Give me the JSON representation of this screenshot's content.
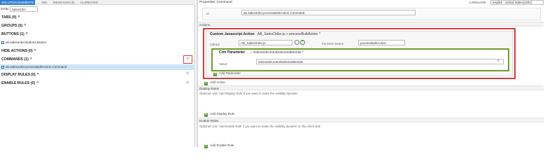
{
  "left_tabs": [
    "SOLUTION ELEMENTS",
    "XML",
    "MESSAGES (0)",
    "CLIPBOARD"
  ],
  "entity": {
    "label": "Entity:",
    "value": "salesorder"
  },
  "sections": {
    "tabs": "TABS (0)",
    "groups": "GROUPS (0)",
    "buttons": "BUTTONS (1)",
    "hide_actions": "HIDE ACTIONS (0)",
    "commands": "COMMANDS (1)",
    "display_rules": "DISPLAY RULES (0)",
    "enable_rules": "ENABLE RULES (0)"
  },
  "button_item": "ab.salesorder.Button2.Button",
  "command_item": "ab.salesorder.processBulkAction.Command",
  "properties_title": "Properties: Command",
  "language": {
    "label": "LANGUAGE:",
    "value": "English - United States(1033)"
  },
  "id": {
    "label": "Id",
    "value": "ab.salesorder.processBulkAction.Command"
  },
  "actions_label": "Actions",
  "cja": {
    "title": "Custom Javascript Action",
    "subtitle": "AB_SalesOrder.js > processBulkAction",
    "library_label": "Library",
    "library_value": "AB_SalesOrder.js",
    "function_label": "Function Name",
    "function_value": "processBulkAction"
  },
  "crm": {
    "title": "Crm Parameter",
    "subtitle": "= SelectedControlSelectedItemIds",
    "value_label": "Value",
    "value": "SelectedControlSelectedItemIds"
  },
  "add_parameter": "Add Parameter",
  "add_action": "Add Action",
  "display_rules_label": "Display Rules",
  "display_optional": "Optional: Use 'Add Display Rule' if you want to make the visibility dynamic.",
  "add_display_rule": "Add Display Rule",
  "enable_rules_label": "Enable Rules",
  "enable_optional": "Optional: Use 'Add Enable Rule' if you want to make the visibility dynamic on the client side",
  "add_enable_rule": "Add Enable Rule",
  "colors": {
    "selected_row": "#cde4f7",
    "tab_active": "#2f7fcf",
    "highlight_red": "#d23b3b",
    "param_green": "#6f9e2d"
  }
}
